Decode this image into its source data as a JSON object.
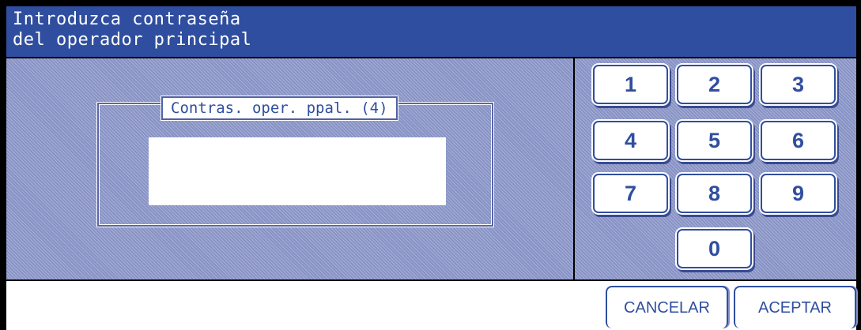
{
  "title": {
    "line1": "Introduzca contraseña",
    "line2": "del operador principal"
  },
  "password": {
    "label": "Contras. oper. ppal. (4)",
    "value": ""
  },
  "keypad": {
    "k1": "1",
    "k2": "2",
    "k3": "3",
    "k4": "4",
    "k5": "5",
    "k6": "6",
    "k7": "7",
    "k8": "8",
    "k9": "9",
    "k0": "0"
  },
  "actions": {
    "cancel": "CANCELAR",
    "accept": "ACEPTAR"
  },
  "colors": {
    "accent": "#2f4e9f",
    "panel": "#8792c5",
    "background": "#000000"
  }
}
